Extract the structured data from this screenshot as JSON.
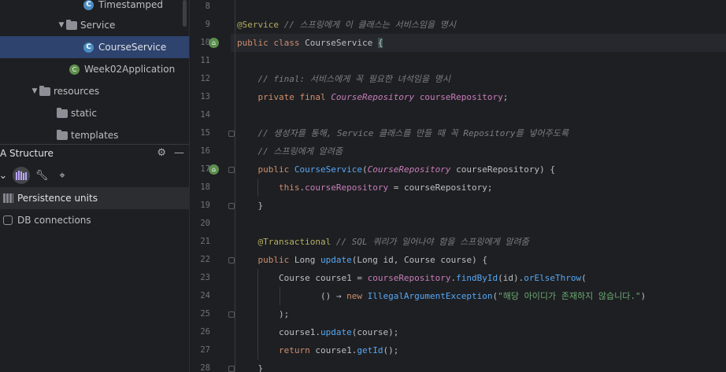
{
  "project_tree": {
    "items": [
      {
        "label": "Timestamped",
        "kind": "class",
        "icon": "class-icon"
      },
      {
        "label": "Service",
        "kind": "folder",
        "icon": "folder-icon",
        "expanded": true
      },
      {
        "label": "CourseService",
        "kind": "class",
        "icon": "class-icon",
        "selected": true
      },
      {
        "label": "Week02Application",
        "kind": "spring-class",
        "icon": "spring-class-icon"
      },
      {
        "label": "resources",
        "kind": "folder",
        "icon": "folder-icon",
        "expanded": true
      },
      {
        "label": "static",
        "kind": "folder",
        "icon": "folder-icon"
      },
      {
        "label": "templates",
        "kind": "folder",
        "icon": "folder-icon"
      }
    ]
  },
  "structure_panel": {
    "title": "A Structure",
    "items": [
      {
        "label": "Persistence units",
        "icon": "persistence-units-icon",
        "selected": true
      },
      {
        "label": "DB connections",
        "icon": "database-icon"
      }
    ]
  },
  "editor": {
    "lines": [
      {
        "n": "8",
        "html": ""
      },
      {
        "n": "9",
        "html": "<span class=\"ann\">@Service</span> <span class=\"cmt\">// 스프링에게 이 클래스는 서비스임을 명시</span>"
      },
      {
        "n": "10",
        "html": "<span class=\"kw\">public class</span> CourseService <span class=\"brace-hl\">{</span>"
      },
      {
        "n": "11",
        "html": ""
      },
      {
        "n": "12",
        "html": "    <span class=\"cmt\">// final: 서비스에게 꼭 필요한 녀석임을 명시</span>"
      },
      {
        "n": "13",
        "html": "    <span class=\"kw\">private final</span> <span class=\"typ\">CourseRepository</span> <span class=\"fld\">courseRepository</span>;"
      },
      {
        "n": "14",
        "html": ""
      },
      {
        "n": "15",
        "html": "    <span class=\"cmt\">// 생성자를 통해, Service 클래스를 만들 때 꼭 Repository를 넣어주도록</span>"
      },
      {
        "n": "16",
        "html": "    <span class=\"cmt\">// 스프링에게 알려줌</span>"
      },
      {
        "n": "17",
        "html": "    <span class=\"kw\">public</span> <span class=\"fn\">CourseService</span>(<span class=\"typ\">CourseRepository</span> courseRepository) {"
      },
      {
        "n": "18",
        "html": "        <span class=\"kw\">this</span>.<span class=\"fld\">courseRepository</span> = courseRepository;"
      },
      {
        "n": "19",
        "html": "    }"
      },
      {
        "n": "20",
        "html": ""
      },
      {
        "n": "21",
        "html": "    <span class=\"ann\">@Transactional</span> <span class=\"cmt\">// SQL 쿼리가 일어나야 함을 스프링에게 알려줌</span>"
      },
      {
        "n": "22",
        "html": "    <span class=\"kw\">public</span> Long <span class=\"fn\">update</span>(Long id, Course course) {"
      },
      {
        "n": "23",
        "html": "        Course course1 = <span class=\"fld\">courseRepository</span>.<span class=\"fn\">findById</span>(id).<span class=\"fn\">orElseThrow</span>("
      },
      {
        "n": "24",
        "html": "                () → <span class=\"kw\">new</span> <span class=\"fn\">IllegalArgumentException</span>(<span class=\"str\">\"해당 아이디가 존재하지 않습니다.\"</span>)"
      },
      {
        "n": "25",
        "html": "        );"
      },
      {
        "n": "26",
        "html": "        course1.<span class=\"fn\">update</span>(course);"
      },
      {
        "n": "27",
        "html": "        <span class=\"kw\">return</span> course1.<span class=\"fn\">getId</span>();"
      },
      {
        "n": "28",
        "html": "    }"
      }
    ]
  }
}
